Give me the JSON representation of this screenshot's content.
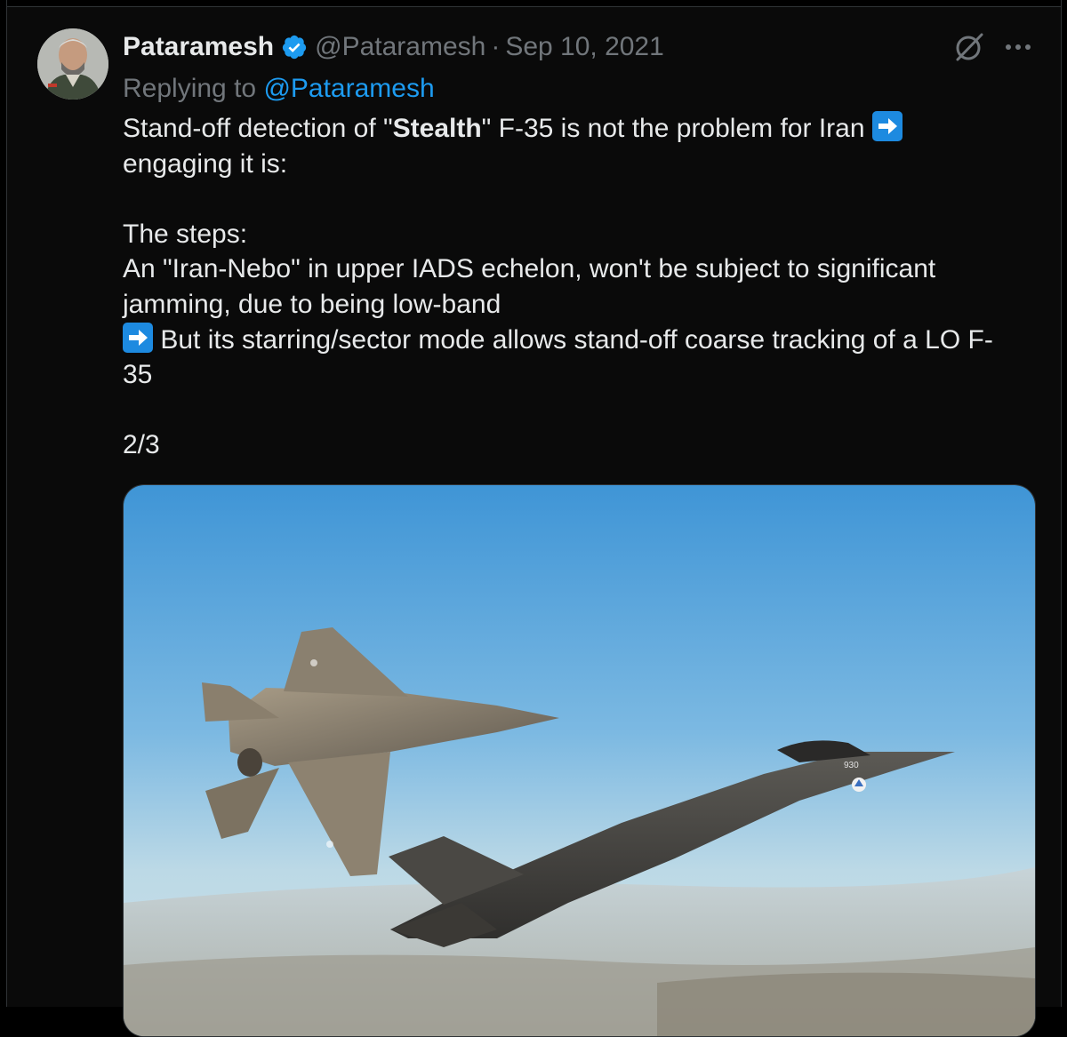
{
  "author": {
    "name": "Pataramesh",
    "handle": "@Pataramesh",
    "date": "Sep 10, 2021",
    "verified": true
  },
  "header": {
    "separator": "·",
    "icons": [
      "grok-icon",
      "more-icon"
    ]
  },
  "reply": {
    "prefix": "Replying to ",
    "mention": "@Pataramesh"
  },
  "tweet": {
    "line1_before_bold": "Stand-off detection of \"",
    "line1_bold": "Stealth",
    "line1_after_bold": "\" F-35 is not the problem for Iran ",
    "line2": "engaging it is:",
    "line3": "The steps:",
    "line4": "An \"Iran-Nebo\" in upper IADS echelon, won't be subject to significant",
    "line5": "jamming, due to being low-band",
    "line6": " But its starring/sector mode allows stand-off coarse tracking of a LO F-",
    "line7": "35",
    "line8": "2/3"
  },
  "media": {
    "aircraft_marking": "930",
    "emoji_icon": "right-arrow-emoji"
  },
  "colors": {
    "background": "#0a0a0a",
    "text": "#e7e9ea",
    "muted": "#71767b",
    "accent": "#1d9bf0",
    "sky_top": "#3f95d6",
    "sky_bottom": "#cfe2ea"
  }
}
